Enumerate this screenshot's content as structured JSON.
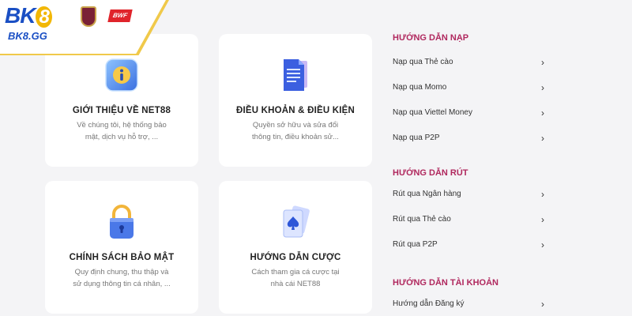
{
  "brand": {
    "logo_text": "BK",
    "logo_digit": "8",
    "logo_sub": "BK8.GG",
    "partner_badge": "BWF"
  },
  "cards": [
    {
      "icon": "info-icon",
      "title": "GIỚI THIỆU VỀ NET88",
      "desc_line1": "Về chúng tôi, hệ thống bảo",
      "desc_line2": "mật, dịch vụ hỗ trợ, ..."
    },
    {
      "icon": "document-icon",
      "title": "ĐIỀU KHOẢN & ĐIỀU KIỆN",
      "desc_line1": "Quyền sở hữu và sửa đổi",
      "desc_line2": "thông tin, điều khoản sử..."
    },
    {
      "icon": "lock-icon",
      "title": "CHÍNH SÁCH BẢO MẬT",
      "desc_line1": "Quy định chung, thu thập và",
      "desc_line2": "sử dụng thông tin cá nhân, ..."
    },
    {
      "icon": "playing-cards-icon",
      "title": "HƯỚNG DẪN CƯỢC",
      "desc_line1": "Cách tham gia cá cược tại",
      "desc_line2": "nhà cái NET88"
    }
  ],
  "guides": {
    "deposit": {
      "heading": "HƯỚNG DẪN NẠP",
      "items": [
        "Nạp qua Thẻ cào",
        "Nạp qua Momo",
        "Nạp qua Viettel Money",
        "Nạp qua P2P"
      ]
    },
    "withdraw": {
      "heading": "HƯỚNG DẪN RÚT",
      "items": [
        "Rút qua Ngân hàng",
        "Rút qua Thẻ cào",
        "Rút qua P2P"
      ]
    },
    "account": {
      "heading": "HƯỚNG DẪN TÀI KHOẢN",
      "items": [
        "Hướng dẫn Đăng ký"
      ]
    }
  },
  "chevron": "›",
  "colors": {
    "accent_heading": "#b0285e",
    "card_bg": "#ffffff",
    "page_bg": "#f4f4f6",
    "brand_blue": "#1a4fc4",
    "brand_gold": "#f2b705"
  }
}
